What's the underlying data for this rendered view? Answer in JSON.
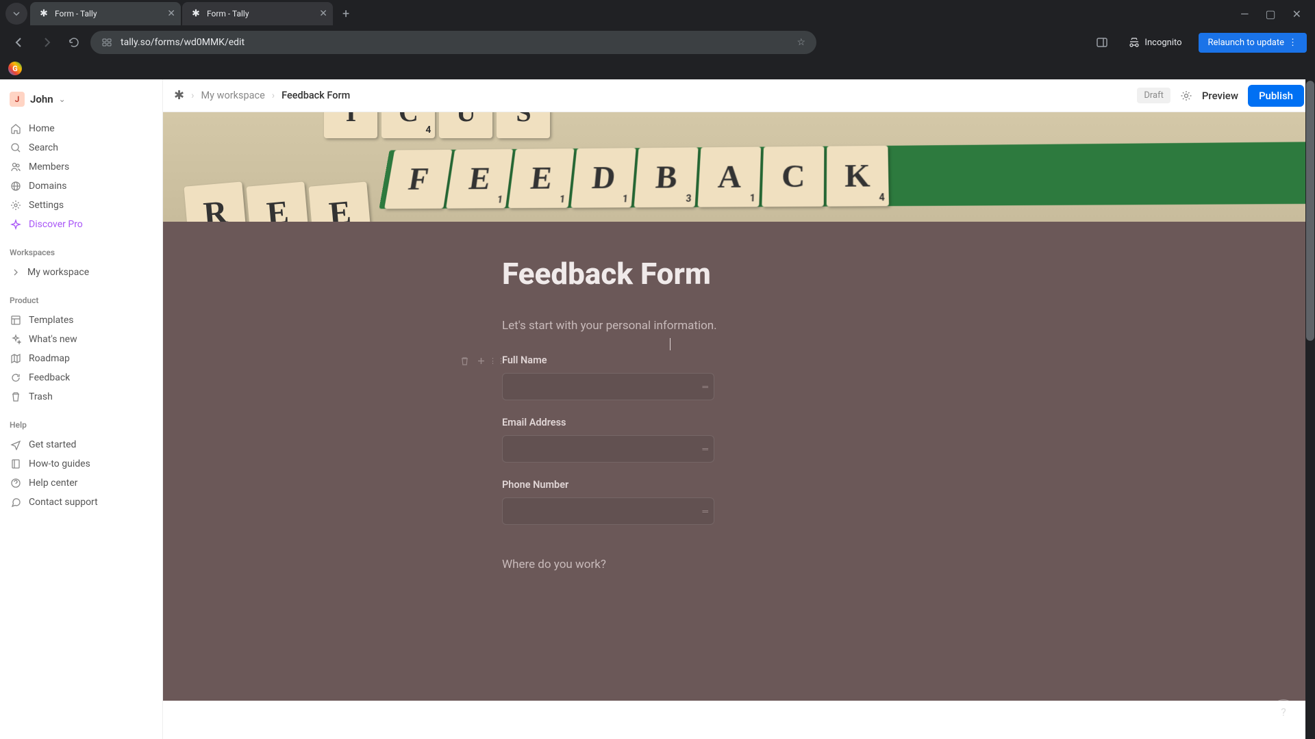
{
  "browser": {
    "tabs": [
      {
        "title": "Form - Tally",
        "active": true
      },
      {
        "title": "Form - Tally",
        "active": false
      }
    ],
    "url": "tally.so/forms/wd0MMK/edit",
    "incognito_label": "Incognito",
    "relaunch_label": "Relaunch to update"
  },
  "sidebar": {
    "user": {
      "initial": "J",
      "name": "John"
    },
    "nav": [
      {
        "icon": "home",
        "label": "Home"
      },
      {
        "icon": "search",
        "label": "Search"
      },
      {
        "icon": "members",
        "label": "Members"
      },
      {
        "icon": "domains",
        "label": "Domains"
      },
      {
        "icon": "settings",
        "label": "Settings"
      },
      {
        "icon": "sparkle",
        "label": "Discover Pro",
        "pro": true
      }
    ],
    "sections": {
      "workspaces_label": "Workspaces",
      "workspaces": [
        {
          "label": "My workspace"
        }
      ],
      "product_label": "Product",
      "product": [
        {
          "icon": "templates",
          "label": "Templates"
        },
        {
          "icon": "sparkle2",
          "label": "What's new"
        },
        {
          "icon": "roadmap",
          "label": "Roadmap"
        },
        {
          "icon": "feedback",
          "label": "Feedback"
        },
        {
          "icon": "trash",
          "label": "Trash"
        }
      ],
      "help_label": "Help",
      "help": [
        {
          "icon": "arrow",
          "label": "Get started"
        },
        {
          "icon": "book",
          "label": "How-to guides"
        },
        {
          "icon": "help",
          "label": "Help center"
        },
        {
          "icon": "chat",
          "label": "Contact support"
        }
      ]
    }
  },
  "topbar": {
    "breadcrumb": {
      "workspace": "My workspace",
      "form": "Feedback Form"
    },
    "draft_label": "Draft",
    "preview_label": "Preview",
    "publish_label": "Publish"
  },
  "form": {
    "title": "Feedback Form",
    "subtitle": "Let's start with your personal information.",
    "fields": [
      {
        "label": "Full Name"
      },
      {
        "label": "Email Address"
      },
      {
        "label": "Phone Number"
      }
    ],
    "question": "Where do you work?"
  },
  "cover": {
    "tiles_top": [
      "I",
      "C",
      "U",
      "S"
    ],
    "tiles_rack": [
      "F",
      "E",
      "E",
      "D",
      "B",
      "A",
      "C",
      "K"
    ],
    "tiles_loose": [
      "R",
      "E",
      "E"
    ]
  }
}
